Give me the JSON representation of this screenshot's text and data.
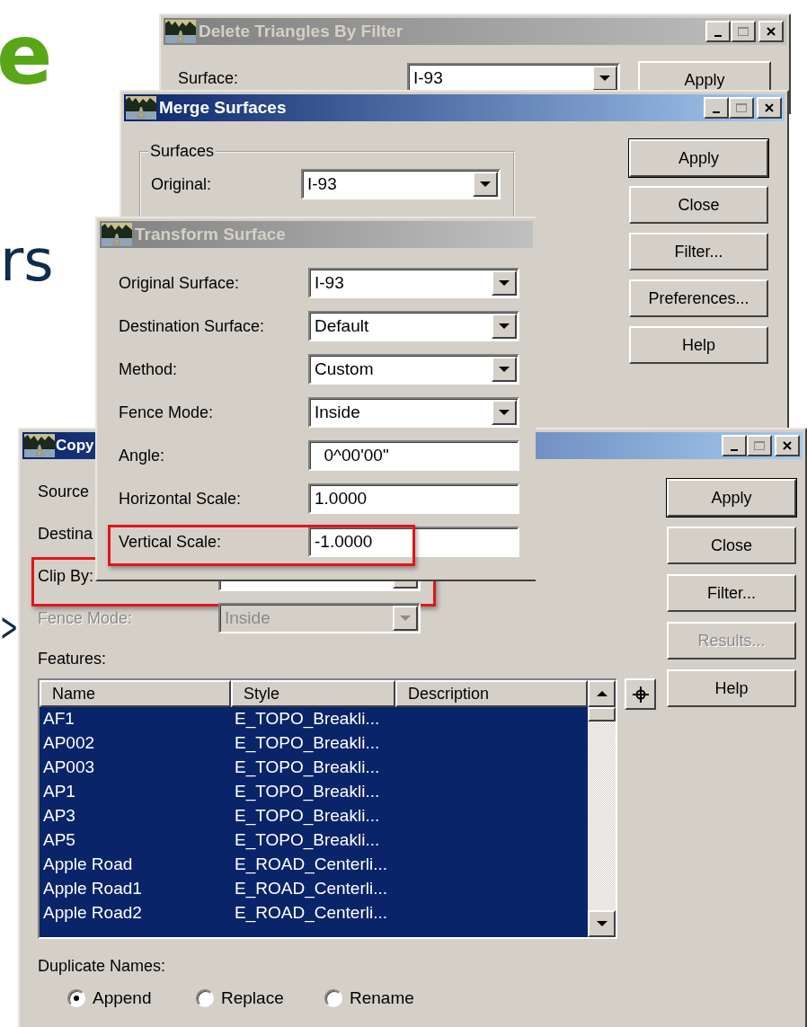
{
  "slide_text": [
    {
      "text": "e",
      "color": "#5aa619"
    },
    {
      "text": "rs",
      "color": "#0f2d4a"
    },
    {
      "text": ">",
      "color": "#0f2d4a"
    }
  ],
  "windows": [
    {
      "kind": "delete",
      "title": "Delete Triangles By Filter",
      "active": false,
      "title_buttons": true,
      "fields": [
        {
          "label": "Surface:",
          "kind": "combo",
          "value": "I-93",
          "disabled": false
        }
      ],
      "buttons": [
        {
          "label": "Apply",
          "default": false,
          "disabled": false
        }
      ]
    },
    {
      "kind": "merge",
      "title": "Merge Surfaces",
      "active": true,
      "title_buttons": true,
      "group": {
        "title": "Surfaces",
        "fields": [
          {
            "label": "Original:",
            "kind": "combo",
            "value": "I-93",
            "disabled": false
          }
        ]
      },
      "buttons": [
        {
          "label": "Apply",
          "default": true,
          "disabled": false
        },
        {
          "label": "Close",
          "default": false,
          "disabled": false
        },
        {
          "label": "Filter...",
          "default": false,
          "disabled": false
        },
        {
          "label": "Preferences...",
          "default": false,
          "disabled": false
        },
        {
          "label": "Help",
          "default": false,
          "disabled": false
        }
      ]
    },
    {
      "kind": "copy",
      "title": "Copy",
      "active": true,
      "title_buttons": true,
      "fields": [
        {
          "label": "Source",
          "kind": "combo",
          "disabled": false
        },
        {
          "label": "Destina",
          "kind": "combo",
          "disabled": false
        },
        {
          "label": "Clip By:",
          "kind": "combo",
          "disabled": false,
          "highlighted": true
        },
        {
          "label": "Fence Mode:",
          "kind": "combo",
          "value": "Inside",
          "disabled": true
        }
      ],
      "list_label": "Features:",
      "table": {
        "columns": [
          "Name",
          "Style",
          "Description"
        ],
        "rows": [
          {
            "name": "AF1",
            "style": "E_TOPO_Breakli...",
            "selected": true
          },
          {
            "name": "AP002",
            "style": "E_TOPO_Breakli...",
            "selected": true
          },
          {
            "name": "AP003",
            "style": "E_TOPO_Breakli...",
            "selected": true
          },
          {
            "name": "AP1",
            "style": "E_TOPO_Breakli...",
            "selected": true
          },
          {
            "name": "AP3",
            "style": "E_TOPO_Breakli...",
            "selected": true
          },
          {
            "name": "AP5",
            "style": "E_TOPO_Breakli...",
            "selected": true
          },
          {
            "name": "Apple Road",
            "style": "E_ROAD_Centerli...",
            "selected": true
          },
          {
            "name": "Apple Road1",
            "style": "E_ROAD_Centerli...",
            "selected": true
          },
          {
            "name": "Apple Road2",
            "style": "E_ROAD_Centerli...",
            "selected": true
          }
        ]
      },
      "duplicate_label": "Duplicate Names:",
      "radios": [
        {
          "label": "Append",
          "selected": true
        },
        {
          "label": "Replace",
          "selected": false
        },
        {
          "label": "Rename",
          "selected": false
        }
      ],
      "buttons": [
        {
          "label": "Apply",
          "default": true,
          "disabled": false
        },
        {
          "label": "Close",
          "default": false,
          "disabled": false
        },
        {
          "label": "Filter...",
          "default": false,
          "disabled": false
        },
        {
          "label": "Results...",
          "default": false,
          "disabled": true
        },
        {
          "label": "Help",
          "default": false,
          "disabled": false
        }
      ]
    },
    {
      "kind": "transform",
      "title": "Transform Surface",
      "active": false,
      "title_buttons": false,
      "fields": [
        {
          "label": "Original Surface:",
          "kind": "combo",
          "value": "I-93",
          "disabled": false,
          "highlighted": false
        },
        {
          "label": "Destination Surface:",
          "kind": "combo",
          "value": "Default",
          "disabled": false,
          "highlighted": false
        },
        {
          "label": "Method:",
          "kind": "combo",
          "value": "Custom",
          "disabled": false,
          "highlighted": false
        },
        {
          "label": "Fence Mode:",
          "kind": "combo",
          "value": "Inside",
          "disabled": false,
          "highlighted": false
        },
        {
          "label": "Angle:",
          "kind": "text",
          "value": "  0^00'00\"",
          "disabled": false,
          "highlighted": false
        },
        {
          "label": "Horizontal Scale:",
          "kind": "text",
          "value": "1.0000",
          "disabled": false,
          "highlighted": false
        },
        {
          "label": "Vertical Scale:",
          "kind": "text",
          "value": "-1.0000",
          "disabled": false,
          "highlighted": true
        }
      ]
    }
  ]
}
